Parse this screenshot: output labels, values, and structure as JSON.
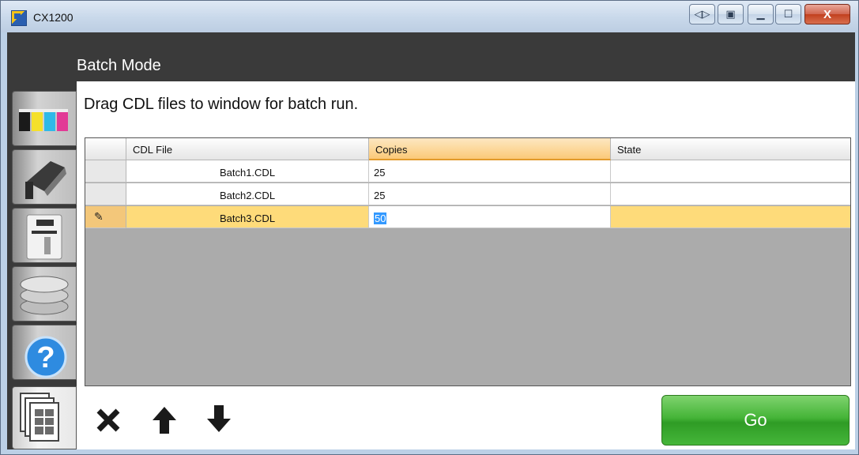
{
  "window": {
    "title": "CX1200",
    "close_glyph": "X"
  },
  "header": {
    "title": "Batch Mode"
  },
  "instruction": "Drag CDL files to window for batch run.",
  "sidebar": {
    "items": [
      {
        "name": "ink-cartridges",
        "icon": "ink-cartridges-icon"
      },
      {
        "name": "printer-maintenance",
        "icon": "printer-head-icon"
      },
      {
        "name": "printer-status",
        "icon": "printer-icon"
      },
      {
        "name": "media-rolls",
        "icon": "media-rolls-icon"
      },
      {
        "name": "help",
        "icon": "question-mark-icon"
      },
      {
        "name": "batch-mode",
        "icon": "batch-pages-icon",
        "active": true
      }
    ]
  },
  "grid": {
    "columns": [
      "CDL File",
      "Copies",
      "State"
    ],
    "selected_column": "Copies",
    "rows": [
      {
        "file": "Batch1.CDL",
        "copies": "25",
        "state": ""
      },
      {
        "file": "Batch2.CDL",
        "copies": "25",
        "state": ""
      },
      {
        "file": "Batch3.CDL",
        "copies": "50",
        "state": "",
        "editing": true
      }
    ]
  },
  "toolbar": {
    "delete_icon": "delete-x-icon",
    "up_icon": "arrow-up-icon",
    "down_icon": "arrow-down-icon"
  },
  "go_button": {
    "label": "Go"
  },
  "colors": {
    "accent_green": "#45b438",
    "selected_row": "#fedb7a",
    "selected_header": "#fcd99d",
    "dark_chrome": "#3a3a3a"
  }
}
